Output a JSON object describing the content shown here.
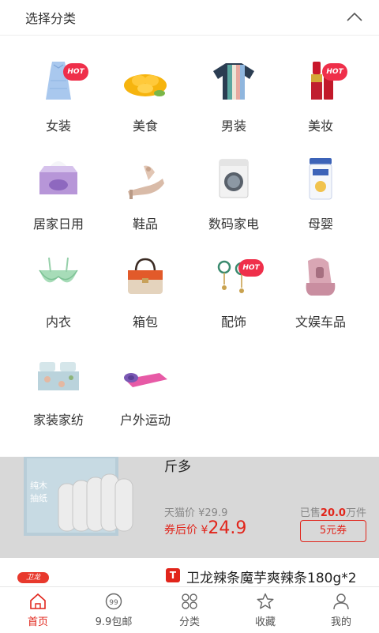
{
  "header": {
    "title": "选择分类"
  },
  "categories": [
    {
      "label": "女装",
      "hot": true
    },
    {
      "label": "美食",
      "hot": false
    },
    {
      "label": "男装",
      "hot": false
    },
    {
      "label": "美妆",
      "hot": true
    },
    {
      "label": "居家日用",
      "hot": false
    },
    {
      "label": "鞋品",
      "hot": false
    },
    {
      "label": "数码家电",
      "hot": false
    },
    {
      "label": "母婴",
      "hot": false
    },
    {
      "label": "内衣",
      "hot": false
    },
    {
      "label": "箱包",
      "hot": false
    },
    {
      "label": "配饰",
      "hot": true
    },
    {
      "label": "文娱车品",
      "hot": false
    },
    {
      "label": "家装家纺",
      "hot": false
    },
    {
      "label": "户外运动",
      "hot": false
    }
  ],
  "hot_badge": "HOT",
  "product1": {
    "title_tail": "斤多",
    "package_text_1": "纯木",
    "package_text_2": "抽纸",
    "tmall_price": "天猫价 ¥29.9",
    "after_coupon_label": "券后价 ¥",
    "after_coupon_value": "24.9",
    "sold_prefix": "已售",
    "sold_value": "20.0",
    "sold_suffix": "万件",
    "coupon": "5元券"
  },
  "product2": {
    "brand_logo": "卫龙",
    "platform_badge": "T",
    "title": "卫龙辣条魔芋爽辣条180g*2"
  },
  "tabs": [
    {
      "label": "首页",
      "icon": "home-icon",
      "active": true
    },
    {
      "label": "9.9包邮",
      "icon": "99-icon",
      "active": false
    },
    {
      "label": "分类",
      "icon": "category-icon",
      "active": false
    },
    {
      "label": "收藏",
      "icon": "star-icon",
      "active": false
    },
    {
      "label": "我的",
      "icon": "user-icon",
      "active": false
    }
  ],
  "colors": {
    "accent": "#e1251b",
    "hot": "#ef2f4a",
    "overlay": "#d8d8d8"
  }
}
